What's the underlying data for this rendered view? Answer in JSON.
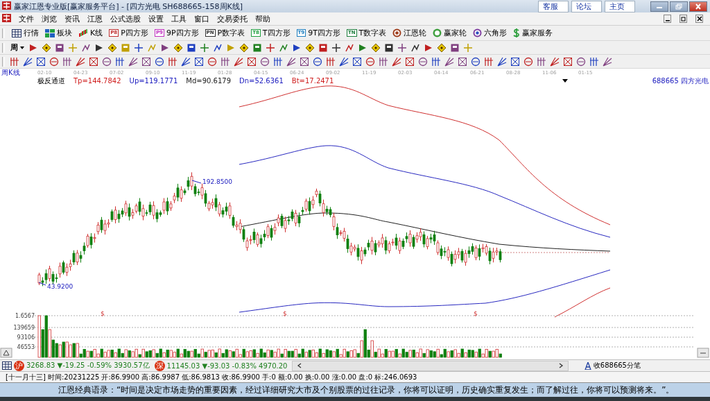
{
  "window": {
    "title": "赢家江恩专业版[赢家服务平台] - [四方光电  SH688665-158周K线]",
    "links": [
      "客服",
      "论坛",
      "主页"
    ]
  },
  "menu": [
    "文件",
    "浏览",
    "资讯",
    "江恩",
    "公式选股",
    "设置",
    "工具",
    "窗口",
    "交易委托",
    "帮助"
  ],
  "toolbar": [
    {
      "kind": "grid",
      "label": "行情"
    },
    {
      "kind": "board",
      "label": "板块"
    },
    {
      "kind": "kline",
      "label": "K线"
    },
    {
      "kind": "badge",
      "badge": "P8",
      "color": "#c03030",
      "label": "P四方形"
    },
    {
      "kind": "badge",
      "badge": "P9",
      "color": "#c030c0",
      "label": "9P四方形"
    },
    {
      "kind": "badge",
      "badge": "PN",
      "color": "#303030",
      "label": "P数字表"
    },
    {
      "kind": "badge",
      "badge": "T8",
      "color": "#20a040",
      "label": "T四方形"
    },
    {
      "kind": "badge",
      "badge": "T9",
      "color": "#2080c0",
      "label": "9T四方形"
    },
    {
      "kind": "badge",
      "badge": "TN",
      "color": "#208040",
      "label": "T数字表"
    },
    {
      "kind": "wheel",
      "label": "江恩轮"
    },
    {
      "kind": "wheel2",
      "label": "赢家轮"
    },
    {
      "kind": "hex",
      "label": "六角形"
    },
    {
      "kind": "dollar",
      "label": "赢家服务"
    }
  ],
  "period_selector": "周",
  "chart": {
    "type_label": "周K线",
    "dates": [
      "02-10",
      "04-23",
      "07-02",
      "09-10",
      "11-19",
      "01-28",
      "04-15",
      "06-24",
      "09-02",
      "11-19",
      "02-03",
      "04-14",
      "06-21",
      "08-28",
      "11-06",
      "01-15"
    ],
    "indicator": {
      "name": "极反通道",
      "values": [
        {
          "text": "Tp=144.7842",
          "color": "#d02020"
        },
        {
          "text": "Up=119.1771",
          "color": "#2020c0"
        },
        {
          "text": "Md=90.6179",
          "color": "#202020"
        },
        {
          "text": "Dn=52.6361",
          "color": "#2020c0"
        },
        {
          "text": "Bt=17.2471",
          "color": "#d02020"
        }
      ]
    },
    "stock": "688665  四方光电",
    "high_label": "192.8500",
    "low_label": "43.9200",
    "markers": [
      "$",
      "$",
      "$"
    ],
    "volume_ticks": [
      "1.6567",
      "139659",
      "93106",
      "46553"
    ]
  },
  "market": [
    {
      "badge": "沪",
      "text": "3268.83 ▼-19.25 -0.59% 3930.57亿"
    },
    {
      "badge": "深",
      "text": "11145.03 ▼-93.03 -0.83% 4970.20"
    }
  ],
  "ticks_button": "收688665分笔",
  "info_bar": "[十一月十三] 时间:20231225 开:86.9900 高:86.9987 低:86.9813 收:86.9900 手:0 额:0.00 换:0.00 涨:0.00 盘:0 标:246.0693",
  "quote": "江恩经典语录：“时间是决定市场走势的重要因素，经过详细研究大市及个别股票的过往记录，你将可以证明，历史确实重复发生；而了解过往，你将可以预测将来。”。"
}
